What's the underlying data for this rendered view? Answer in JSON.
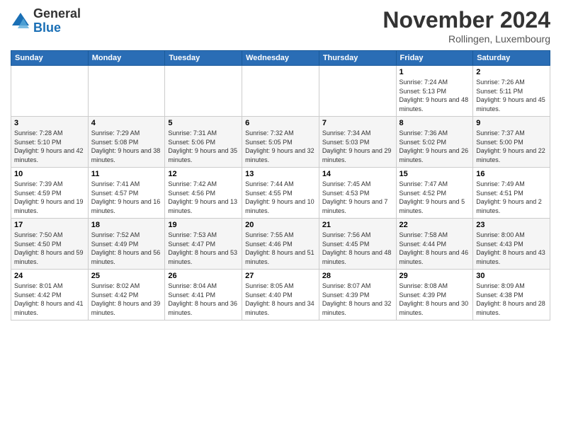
{
  "logo": {
    "general": "General",
    "blue": "Blue"
  },
  "title": "November 2024",
  "location": "Rollingen, Luxembourg",
  "weekdays": [
    "Sunday",
    "Monday",
    "Tuesday",
    "Wednesday",
    "Thursday",
    "Friday",
    "Saturday"
  ],
  "weeks": [
    [
      {
        "day": "",
        "sunrise": "",
        "sunset": "",
        "daylight": ""
      },
      {
        "day": "",
        "sunrise": "",
        "sunset": "",
        "daylight": ""
      },
      {
        "day": "",
        "sunrise": "",
        "sunset": "",
        "daylight": ""
      },
      {
        "day": "",
        "sunrise": "",
        "sunset": "",
        "daylight": ""
      },
      {
        "day": "",
        "sunrise": "",
        "sunset": "",
        "daylight": ""
      },
      {
        "day": "1",
        "sunrise": "Sunrise: 7:24 AM",
        "sunset": "Sunset: 5:13 PM",
        "daylight": "Daylight: 9 hours and 48 minutes."
      },
      {
        "day": "2",
        "sunrise": "Sunrise: 7:26 AM",
        "sunset": "Sunset: 5:11 PM",
        "daylight": "Daylight: 9 hours and 45 minutes."
      }
    ],
    [
      {
        "day": "3",
        "sunrise": "Sunrise: 7:28 AM",
        "sunset": "Sunset: 5:10 PM",
        "daylight": "Daylight: 9 hours and 42 minutes."
      },
      {
        "day": "4",
        "sunrise": "Sunrise: 7:29 AM",
        "sunset": "Sunset: 5:08 PM",
        "daylight": "Daylight: 9 hours and 38 minutes."
      },
      {
        "day": "5",
        "sunrise": "Sunrise: 7:31 AM",
        "sunset": "Sunset: 5:06 PM",
        "daylight": "Daylight: 9 hours and 35 minutes."
      },
      {
        "day": "6",
        "sunrise": "Sunrise: 7:32 AM",
        "sunset": "Sunset: 5:05 PM",
        "daylight": "Daylight: 9 hours and 32 minutes."
      },
      {
        "day": "7",
        "sunrise": "Sunrise: 7:34 AM",
        "sunset": "Sunset: 5:03 PM",
        "daylight": "Daylight: 9 hours and 29 minutes."
      },
      {
        "day": "8",
        "sunrise": "Sunrise: 7:36 AM",
        "sunset": "Sunset: 5:02 PM",
        "daylight": "Daylight: 9 hours and 26 minutes."
      },
      {
        "day": "9",
        "sunrise": "Sunrise: 7:37 AM",
        "sunset": "Sunset: 5:00 PM",
        "daylight": "Daylight: 9 hours and 22 minutes."
      }
    ],
    [
      {
        "day": "10",
        "sunrise": "Sunrise: 7:39 AM",
        "sunset": "Sunset: 4:59 PM",
        "daylight": "Daylight: 9 hours and 19 minutes."
      },
      {
        "day": "11",
        "sunrise": "Sunrise: 7:41 AM",
        "sunset": "Sunset: 4:57 PM",
        "daylight": "Daylight: 9 hours and 16 minutes."
      },
      {
        "day": "12",
        "sunrise": "Sunrise: 7:42 AM",
        "sunset": "Sunset: 4:56 PM",
        "daylight": "Daylight: 9 hours and 13 minutes."
      },
      {
        "day": "13",
        "sunrise": "Sunrise: 7:44 AM",
        "sunset": "Sunset: 4:55 PM",
        "daylight": "Daylight: 9 hours and 10 minutes."
      },
      {
        "day": "14",
        "sunrise": "Sunrise: 7:45 AM",
        "sunset": "Sunset: 4:53 PM",
        "daylight": "Daylight: 9 hours and 7 minutes."
      },
      {
        "day": "15",
        "sunrise": "Sunrise: 7:47 AM",
        "sunset": "Sunset: 4:52 PM",
        "daylight": "Daylight: 9 hours and 5 minutes."
      },
      {
        "day": "16",
        "sunrise": "Sunrise: 7:49 AM",
        "sunset": "Sunset: 4:51 PM",
        "daylight": "Daylight: 9 hours and 2 minutes."
      }
    ],
    [
      {
        "day": "17",
        "sunrise": "Sunrise: 7:50 AM",
        "sunset": "Sunset: 4:50 PM",
        "daylight": "Daylight: 8 hours and 59 minutes."
      },
      {
        "day": "18",
        "sunrise": "Sunrise: 7:52 AM",
        "sunset": "Sunset: 4:49 PM",
        "daylight": "Daylight: 8 hours and 56 minutes."
      },
      {
        "day": "19",
        "sunrise": "Sunrise: 7:53 AM",
        "sunset": "Sunset: 4:47 PM",
        "daylight": "Daylight: 8 hours and 53 minutes."
      },
      {
        "day": "20",
        "sunrise": "Sunrise: 7:55 AM",
        "sunset": "Sunset: 4:46 PM",
        "daylight": "Daylight: 8 hours and 51 minutes."
      },
      {
        "day": "21",
        "sunrise": "Sunrise: 7:56 AM",
        "sunset": "Sunset: 4:45 PM",
        "daylight": "Daylight: 8 hours and 48 minutes."
      },
      {
        "day": "22",
        "sunrise": "Sunrise: 7:58 AM",
        "sunset": "Sunset: 4:44 PM",
        "daylight": "Daylight: 8 hours and 46 minutes."
      },
      {
        "day": "23",
        "sunrise": "Sunrise: 8:00 AM",
        "sunset": "Sunset: 4:43 PM",
        "daylight": "Daylight: 8 hours and 43 minutes."
      }
    ],
    [
      {
        "day": "24",
        "sunrise": "Sunrise: 8:01 AM",
        "sunset": "Sunset: 4:42 PM",
        "daylight": "Daylight: 8 hours and 41 minutes."
      },
      {
        "day": "25",
        "sunrise": "Sunrise: 8:02 AM",
        "sunset": "Sunset: 4:42 PM",
        "daylight": "Daylight: 8 hours and 39 minutes."
      },
      {
        "day": "26",
        "sunrise": "Sunrise: 8:04 AM",
        "sunset": "Sunset: 4:41 PM",
        "daylight": "Daylight: 8 hours and 36 minutes."
      },
      {
        "day": "27",
        "sunrise": "Sunrise: 8:05 AM",
        "sunset": "Sunset: 4:40 PM",
        "daylight": "Daylight: 8 hours and 34 minutes."
      },
      {
        "day": "28",
        "sunrise": "Sunrise: 8:07 AM",
        "sunset": "Sunset: 4:39 PM",
        "daylight": "Daylight: 8 hours and 32 minutes."
      },
      {
        "day": "29",
        "sunrise": "Sunrise: 8:08 AM",
        "sunset": "Sunset: 4:39 PM",
        "daylight": "Daylight: 8 hours and 30 minutes."
      },
      {
        "day": "30",
        "sunrise": "Sunrise: 8:09 AM",
        "sunset": "Sunset: 4:38 PM",
        "daylight": "Daylight: 8 hours and 28 minutes."
      }
    ]
  ]
}
